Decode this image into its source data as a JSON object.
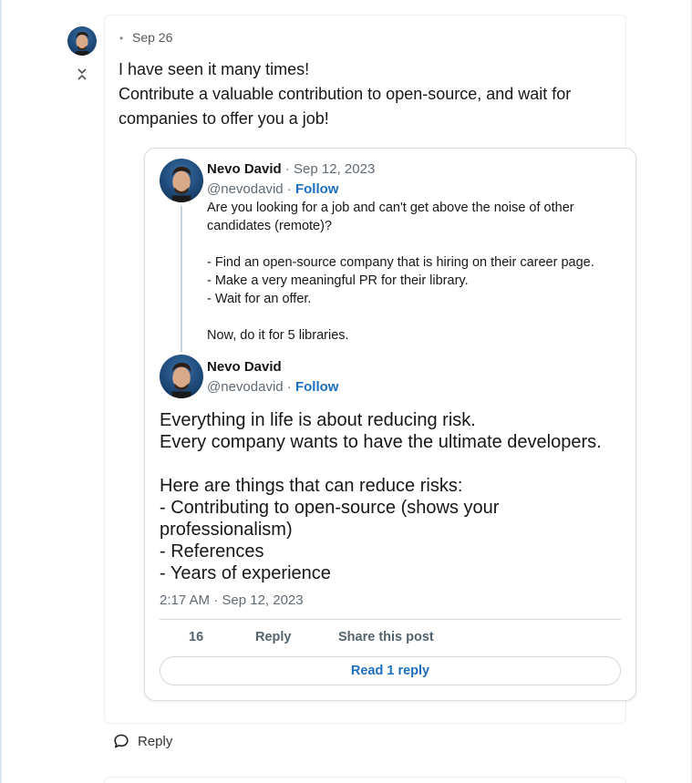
{
  "comment": {
    "date": "Sep 26",
    "body": [
      "I have seen it many times!",
      "Contribute a valuable contribution to open-source, and wait for companies to offer you a job!"
    ],
    "reply_label": "Reply"
  },
  "embed": {
    "tweet1": {
      "author_name": "Nevo David",
      "date": "Sep 12, 2023",
      "handle": "@nevodavid",
      "follow_label": "Follow",
      "text": "Are you looking for a job and can't get above the noise of other candidates (remote)?\n\n- Find an open-source company that is hiring on their career page.\n- Make a very meaningful PR for their library.\n- Wait for an offer.\n\nNow, do it for 5 libraries."
    },
    "tweet2": {
      "author_name": "Nevo David",
      "handle": "@nevodavid",
      "follow_label": "Follow",
      "text": "Everything in life is about reducing risk.\nEvery company wants to have the ultimate developers.\n\nHere are things that can reduce risks:\n- Contributing to open-source (shows your professionalism)\n- References\n- Years of experience",
      "timestamp": "2:17 AM · Sep 12, 2023",
      "like_count": "16",
      "reply_label": "Reply",
      "share_label": "Share this post",
      "read_replies_label": "Read 1 reply"
    }
  },
  "icons": {
    "collapse": "collapse-chevrons-icon",
    "reply": "speech-bubble-icon"
  },
  "colors": {
    "link": "#1d6fbf",
    "muted": "#606a73",
    "avatar_bg": "#1e4a7a"
  }
}
